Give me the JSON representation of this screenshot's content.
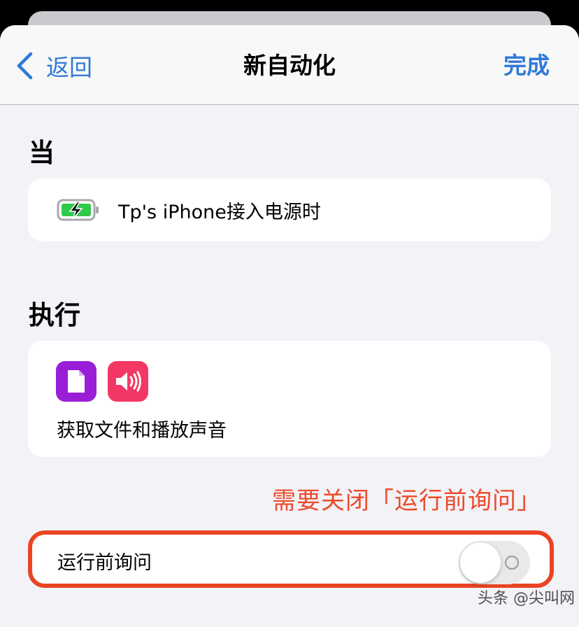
{
  "navbar": {
    "back_label": "返回",
    "title": "新自动化",
    "done_label": "完成"
  },
  "when": {
    "title": "当",
    "trigger_text": "Tp's iPhone接入电源时",
    "trigger_icon": "battery-charging-icon"
  },
  "do": {
    "title": "执行",
    "action_icons": [
      "file-icon",
      "speaker-icon"
    ],
    "action_text": "获取文件和播放声音"
  },
  "annotation": "需要关闭「运行前询问」",
  "ask_before_running": {
    "label": "运行前询问",
    "enabled": false
  },
  "watermark": "头条 @尖叫网",
  "colors": {
    "accent": "#2f7ad8",
    "annotation": "#ea4422",
    "file_icon_bg": "#9a1ed8",
    "sound_icon_bg": "#f43865",
    "battery_green": "#2fc94b"
  }
}
